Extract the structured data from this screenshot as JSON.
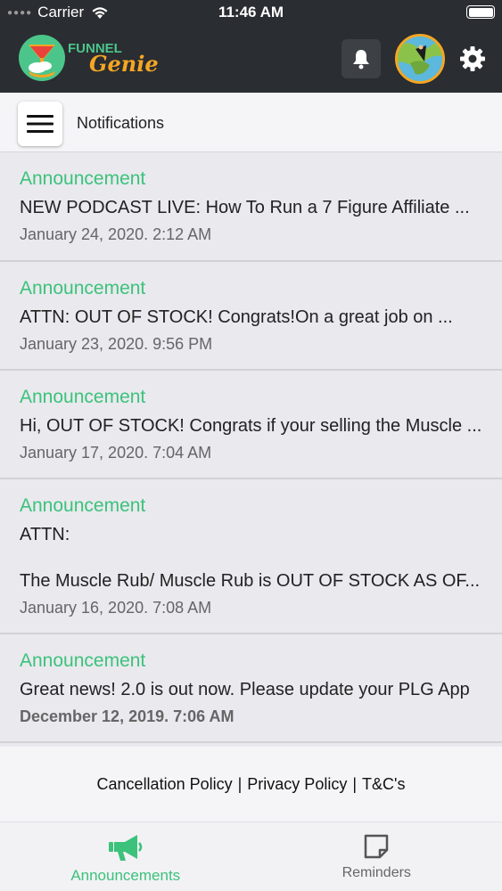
{
  "status_bar": {
    "carrier": "Carrier",
    "time": "11:46 AM"
  },
  "header": {
    "logo_line1": "FUNNEL",
    "logo_line2": "Genie",
    "icons": [
      "bell-icon",
      "avatar",
      "gear-icon"
    ]
  },
  "subheader": {
    "title": "Notifications"
  },
  "notifications": [
    {
      "type": "Announcement",
      "text": "NEW PODCAST LIVE: How To Run a 7 Figure Affiliate ...",
      "date": "January 24, 2020. 2:12 AM"
    },
    {
      "type": "Announcement",
      "text": "ATTN: OUT OF STOCK! Congrats!On a great job on ...",
      "date": "January 23, 2020. 9:56 PM"
    },
    {
      "type": "Announcement",
      "text": "Hi, OUT OF STOCK! Congrats if your selling the Muscle ...",
      "date": "January 17, 2020. 7:04 AM"
    },
    {
      "type": "Announcement",
      "text_line1": "ATTN:",
      "text_line2": "The Muscle Rub/ Muscle Rub is OUT OF STOCK AS OF...",
      "date": "January 16, 2020. 7:08 AM"
    },
    {
      "type": "Announcement",
      "text": "Great news! 2.0 is out now. Please update your PLG App",
      "date": "December 12, 2019. 7:06 AM"
    }
  ],
  "footer": {
    "cancellation": "Cancellation Policy",
    "privacy": "Privacy Policy",
    "terms": "T&C's",
    "separator": "|"
  },
  "tabs": [
    {
      "label": "Announcements",
      "icon": "megaphone-icon",
      "active": true
    },
    {
      "label": "Reminders",
      "icon": "note-icon",
      "active": false
    }
  ],
  "colors": {
    "header_bg": "#2a2d31",
    "accent_green": "#3cc27b",
    "logo_orange": "#f5a623"
  }
}
